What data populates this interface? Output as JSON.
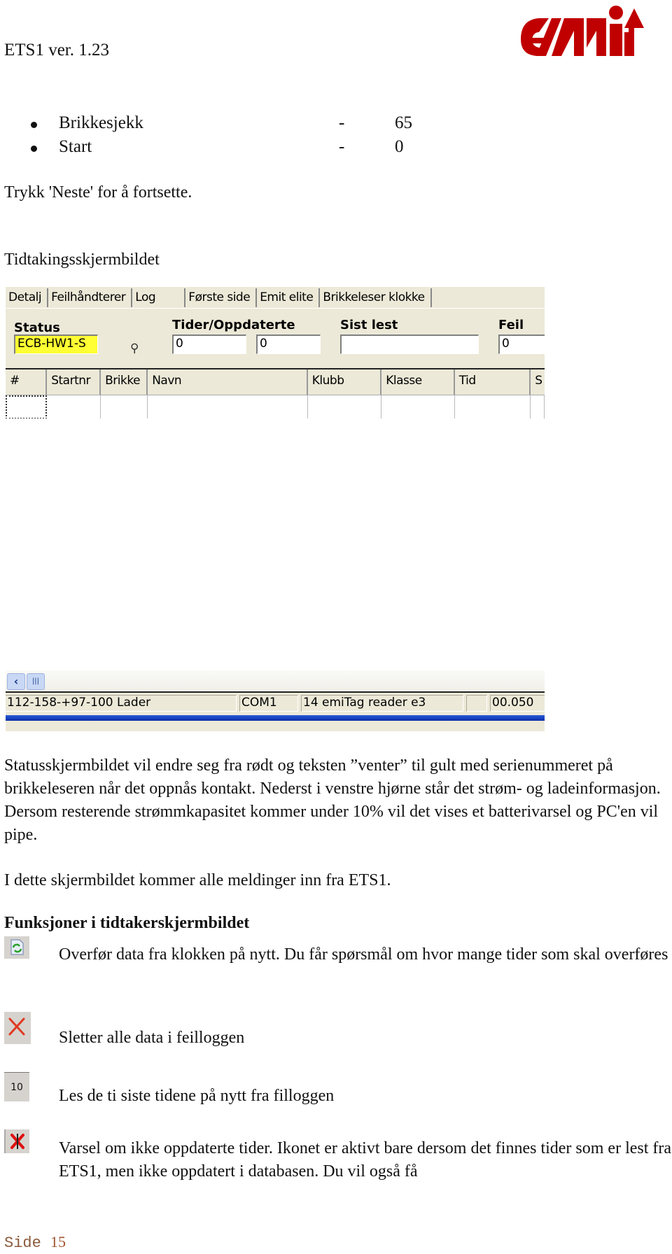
{
  "header": {
    "title": "ETS1 ver. 1.23",
    "logo_text": "emit",
    "logo_color": "#c00000"
  },
  "bullets": [
    {
      "label": "Brikkesjekk",
      "dash": "-",
      "value": "65"
    },
    {
      "label": "Start",
      "dash": "-",
      "value": "0"
    }
  ],
  "intro_text": "Trykk 'Neste' for å fortsette.",
  "section_title": "Tidtakingsskjermbildet",
  "app": {
    "tabs": [
      "Detalj",
      "Feilhåndterer",
      "Log",
      "Første side",
      "Emit elite",
      "Brikkeleser klokke"
    ],
    "fields": {
      "status_label": "Status",
      "status_value": "ECB-HW1-S",
      "status_color": "#ffff33",
      "tider_label": "Tider/Oppdaterte",
      "tider_value": "0",
      "oppdaterte_value": "0",
      "sist_lest_label": "Sist lest",
      "sist_lest_value": "",
      "feil_label": "Feil",
      "feil_value": "0"
    },
    "bulb_icon": "lightbulb-icon",
    "columns": [
      "#",
      "Startnr",
      "Brikke",
      "Navn",
      "Klubb",
      "Klasse",
      "Tid",
      "S"
    ],
    "scrollbar": {
      "left_arrow": "‹",
      "thumb": "|||"
    },
    "statusbar": {
      "power": "112-158-+97-100 Lader",
      "port": "COM1",
      "reader": "14 emiTag reader e3",
      "empty": "",
      "time": "00.050"
    }
  },
  "description": "Statusskjermbildet vil endre seg fra rødt og teksten ”venter” til gult med serienummeret på brikkeleseren når det oppnås kontakt. Nederst i venstre hjørne står det strøm- og ladeinformasjon. Dersom resterende strømmkapasitet kommer under 10% vil det vises et batterivarsel og PC'en vil pipe.",
  "messages_text": "I dette skjermbildet kommer alle meldinger inn fra ETS1.",
  "functions_title": "Funksjoner i tidtakerskjermbildet",
  "functions": [
    {
      "icon": "refresh-transfer-icon",
      "text": "Overfør data fra klokken på nytt. Du får spørsmål om hvor mange tider som skal overføres"
    },
    {
      "icon": "delete-x-icon",
      "text": "Sletter alle data i feilloggen"
    },
    {
      "icon": "ten-icon",
      "icon_label": "10",
      "text": "Les de ti siste tidene på nytt fra filloggen"
    },
    {
      "icon": "warning-x-icon",
      "text": "Varsel om ikke oppdaterte tider.  Ikonet er aktivt bare dersom det finnes tider som er lest fra ETS1, men ikke oppdatert i databasen. Du vil også få"
    }
  ],
  "footer": {
    "label": "Side",
    "page": "15"
  }
}
